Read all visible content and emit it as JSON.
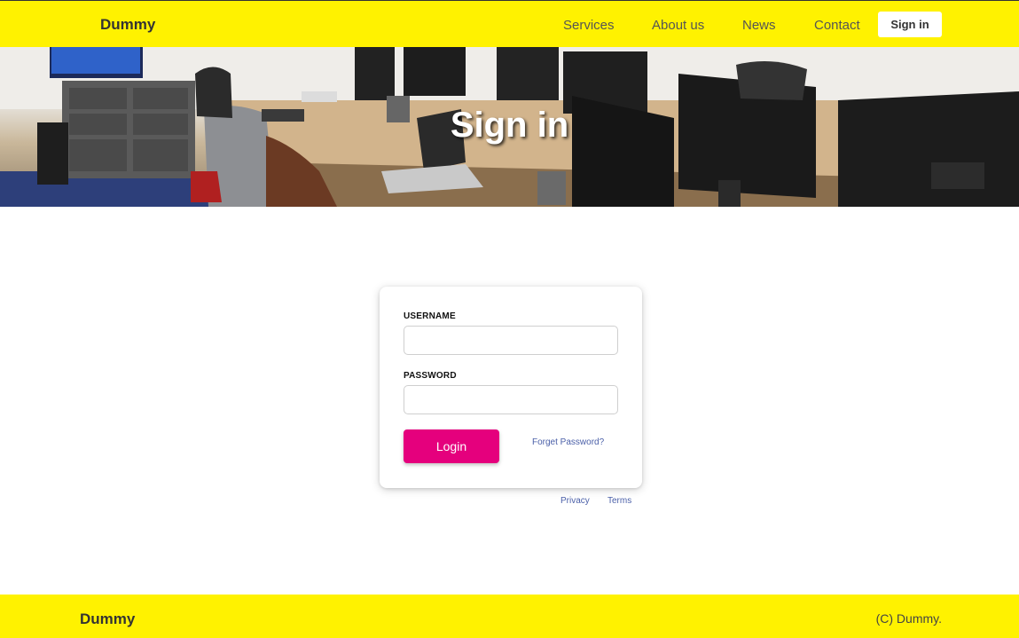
{
  "header": {
    "brand": "Dummy",
    "nav": [
      "Services",
      "About us",
      "News",
      "Contact"
    ],
    "sign_in": "Sign in"
  },
  "hero": {
    "title": "Sign in"
  },
  "form": {
    "username_label": "USERNAME",
    "username_value": "",
    "password_label": "PASSWORD",
    "password_value": "",
    "login_label": "Login",
    "forgot_label": "Forget Password?"
  },
  "links": {
    "privacy": "Privacy",
    "terms": "Terms"
  },
  "footer": {
    "brand": "Dummy",
    "copyright": "(C) Dummy."
  },
  "colors": {
    "header_bg": "#fff200",
    "login_button": "#e5007d",
    "link": "#4a5fa8"
  }
}
